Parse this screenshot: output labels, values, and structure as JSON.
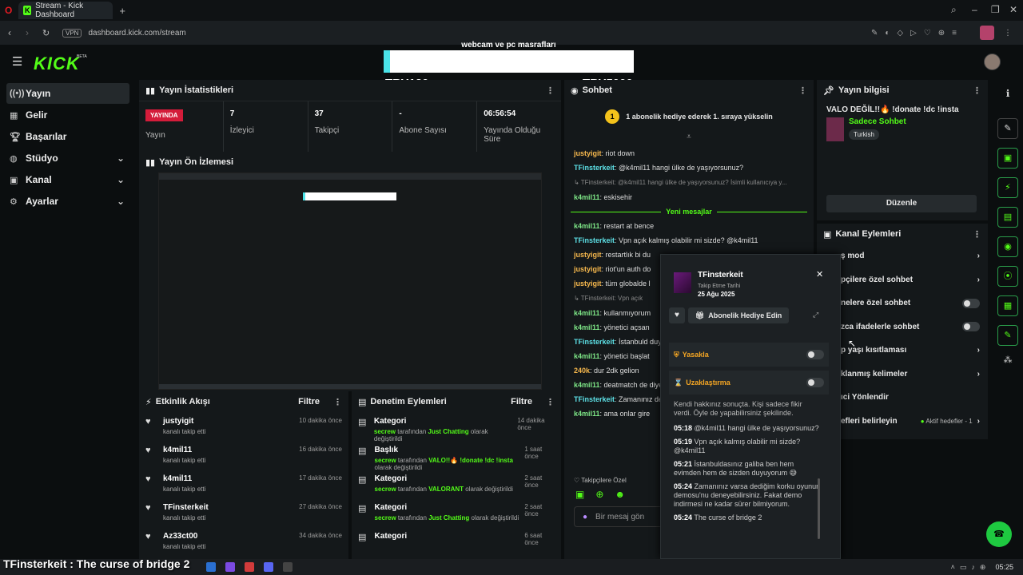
{
  "browser": {
    "tab_title": "Stream - Kick Dashboard",
    "url": "dashboard.kick.com/stream",
    "vpn": "VPN"
  },
  "header": {
    "logo": "KICK",
    "goal_title": "webcam ve pc masrafları",
    "goal_left": "TRY120",
    "goal_right": "TRY5000"
  },
  "sidebar": {
    "items": [
      {
        "label": "Yayın",
        "icon": "signal-icon"
      },
      {
        "label": "Gelir",
        "icon": "chart-icon"
      },
      {
        "label": "Başarılar",
        "icon": "trophy-icon"
      },
      {
        "label": "Stüdyo",
        "icon": "studio-icon"
      },
      {
        "label": "Kanal",
        "icon": "channel-icon"
      },
      {
        "label": "Ayarlar",
        "icon": "gear-icon"
      }
    ]
  },
  "stats": {
    "title": "Yayın İstatistikleri",
    "live_badge": "YAYINDA",
    "live_label": "Yayın",
    "viewers": "7",
    "viewers_label": "İzleyici",
    "followers": "37",
    "followers_label": "Takipçi",
    "subs": "-",
    "subs_label": "Abone Sayısı",
    "uptime": "06:56:54",
    "uptime_label": "Yayında Olduğu Süre"
  },
  "preview": {
    "title": "Yayın Ön İzlemesi"
  },
  "activity": {
    "title": "Etkinlik Akışı",
    "filter": "Filtre",
    "items": [
      {
        "name": "justyigit",
        "sub": "kanalı takip etti",
        "time": "10 dakika önce"
      },
      {
        "name": "k4mil11",
        "sub": "kanalı takip etti",
        "time": "16 dakika önce"
      },
      {
        "name": "k4mil11",
        "sub": "kanalı takip etti",
        "time": "17 dakika önce"
      },
      {
        "name": "TFinsterkeit",
        "sub": "kanalı takip etti",
        "time": "27 dakika önce"
      },
      {
        "name": "Az33ct00",
        "sub": "kanalı takip etti",
        "time": "34 dakika önce"
      }
    ]
  },
  "moderation": {
    "title": "Denetim Eylemleri",
    "filter": "Filtre",
    "items": [
      {
        "name": "Kategori",
        "user": "secrew",
        "pre": "tarafından",
        "val": "Just Chatting",
        "post": "olarak değiştirildi",
        "time": "14 dakika önce"
      },
      {
        "name": "Başlık",
        "user": "secrew",
        "pre": "tarafından",
        "val": "VALO!!🔥 !donate !dc !insta",
        "post": "olarak değiştirildi",
        "time": "1 saat önce"
      },
      {
        "name": "Kategori",
        "user": "secrew",
        "pre": "tarafından",
        "val": "VALORANT",
        "post": "olarak değiştirildi",
        "time": "2 saat önce"
      },
      {
        "name": "Kategori",
        "user": "secrew",
        "pre": "tarafından",
        "val": "Just Chatting",
        "post": "olarak değiştirildi",
        "time": "2 saat önce"
      },
      {
        "name": "Kategori",
        "user": "",
        "pre": "",
        "val": "",
        "post": "",
        "time": "6 saat önce"
      }
    ]
  },
  "chat": {
    "title": "Sohbet",
    "pinned": "1 abonelik hediye ederek 1. sıraya yükselin",
    "new_messages": "Yeni mesajlar",
    "input_placeholder": "Bir mesaj gön",
    "followers_only": "Takipçilere Özel",
    "messages": [
      {
        "u": "justyigit",
        "t": "riot down",
        "c": "u1"
      },
      {
        "u": "TFinsterkeit",
        "t": "@k4mil11 hangi ülke de yaşıyorsunuz?",
        "c": "u2"
      },
      {
        "u": "",
        "t": "↳ TFinsterkeit: @k4mil11 hangi ülke de yaşıyorsunuz? İsimli kullanıcıya y...",
        "c": ""
      },
      {
        "u": "k4mil11",
        "t": "eskisehir",
        "c": "u3"
      }
    ],
    "messages2": [
      {
        "u": "k4mil11",
        "t": "restart at bence",
        "c": "u3"
      },
      {
        "u": "TFinsterkeit",
        "t": "Vpn açık kalmış olabilir mi sizde? @k4mil11",
        "c": "u2"
      },
      {
        "u": "justyigit",
        "t": "restartlık bi du",
        "c": "u1"
      },
      {
        "u": "justyigit",
        "t": "riot'un auth do",
        "c": "u1"
      },
      {
        "u": "justyigit",
        "t": "tüm globalde l",
        "c": "u1"
      },
      {
        "u": "",
        "t": "↳ TFinsterkeit: Vpn açık",
        "c": ""
      },
      {
        "u": "k4mil11",
        "t": "kullanmıyorum",
        "c": "u3"
      },
      {
        "u": "k4mil11",
        "t": "yönetici açsan",
        "c": "u3"
      },
      {
        "u": "TFinsterkeit",
        "t": "İstanbuld duyuyorum 😅",
        "c": "u2"
      },
      {
        "u": "k4mil11",
        "t": "yönetici başlat",
        "c": "u3"
      },
      {
        "u": "240k",
        "t": "dur 2dk gelion",
        "c": "u1"
      },
      {
        "u": "k4mil11",
        "t": "deatmatch de diye",
        "c": "u3"
      },
      {
        "u": "TFinsterkeit",
        "t": "Zamanınız deneyebilirsiniz",
        "c": "u2"
      },
      {
        "u": "k4mil11",
        "t": "ama onlar gire",
        "c": "u3"
      }
    ]
  },
  "info": {
    "title": "Yayın bilgisi",
    "stream_title": "VALO DEĞİL!!🔥 !donate !dc !insta",
    "category": "Sadece Sohbet",
    "tag": "Turkish",
    "edit": "Düzenle"
  },
  "channel_actions": {
    "title": "Kanal Eylemleri",
    "items": [
      {
        "label": "ş mod",
        "ctl": "chev"
      },
      {
        "label": "pçilere özel sohbet",
        "ctl": "chev"
      },
      {
        "label": "nelere özel sohbet",
        "ctl": "toggle"
      },
      {
        "label": "zca ifadelerle sohbet",
        "ctl": "toggle"
      },
      {
        "label": "p yaşı kısıtlaması",
        "ctl": "chev"
      },
      {
        "label": "klanmış kelimeler",
        "ctl": "chev"
      },
      {
        "label": "ıci Yönlendir",
        "ctl": ""
      },
      {
        "label": "efleri belirleyin",
        "ctl": "goal"
      }
    ],
    "goal_text": "Aktif hedefler - 1"
  },
  "popup": {
    "user": "TFinsterkeit",
    "follow_label": "Takip Etme Tarihi",
    "follow_date": "25 Ağu 2025",
    "gift": "Abonelik Hediye Edin",
    "ban": "Yasakla",
    "timeout": "Uzaklaştırma",
    "history_head": "Kendi hakkınız sonuçta. Kişi sadece fikir verdi. Öyle de yapabilirsiniz şekilinde.",
    "history": [
      {
        "time": "05:18",
        "text": "@k4mil11 hangi ülke de yaşıyorsunuz?"
      },
      {
        "time": "05:19",
        "text": "Vpn açık kalmış olabilir mi sizde? @k4mil11"
      },
      {
        "time": "05:21",
        "text": "İstanbuldasınız galiba ben hem evimden hem de sizden duyuyorum 😅"
      },
      {
        "time": "05:24",
        "text": "Zamanınız varsa dediğim korku oyunun demosu'nu deneyebilirsiniz. Fakat demo indirmesi ne kadar sürer bilmiyorum."
      },
      {
        "time": "05:24",
        "text": "The curse of bridge 2"
      }
    ]
  },
  "overlay": {
    "caption": "TFinsterkeit : The curse of bridge 2"
  },
  "taskbar": {
    "time": "05:25"
  }
}
